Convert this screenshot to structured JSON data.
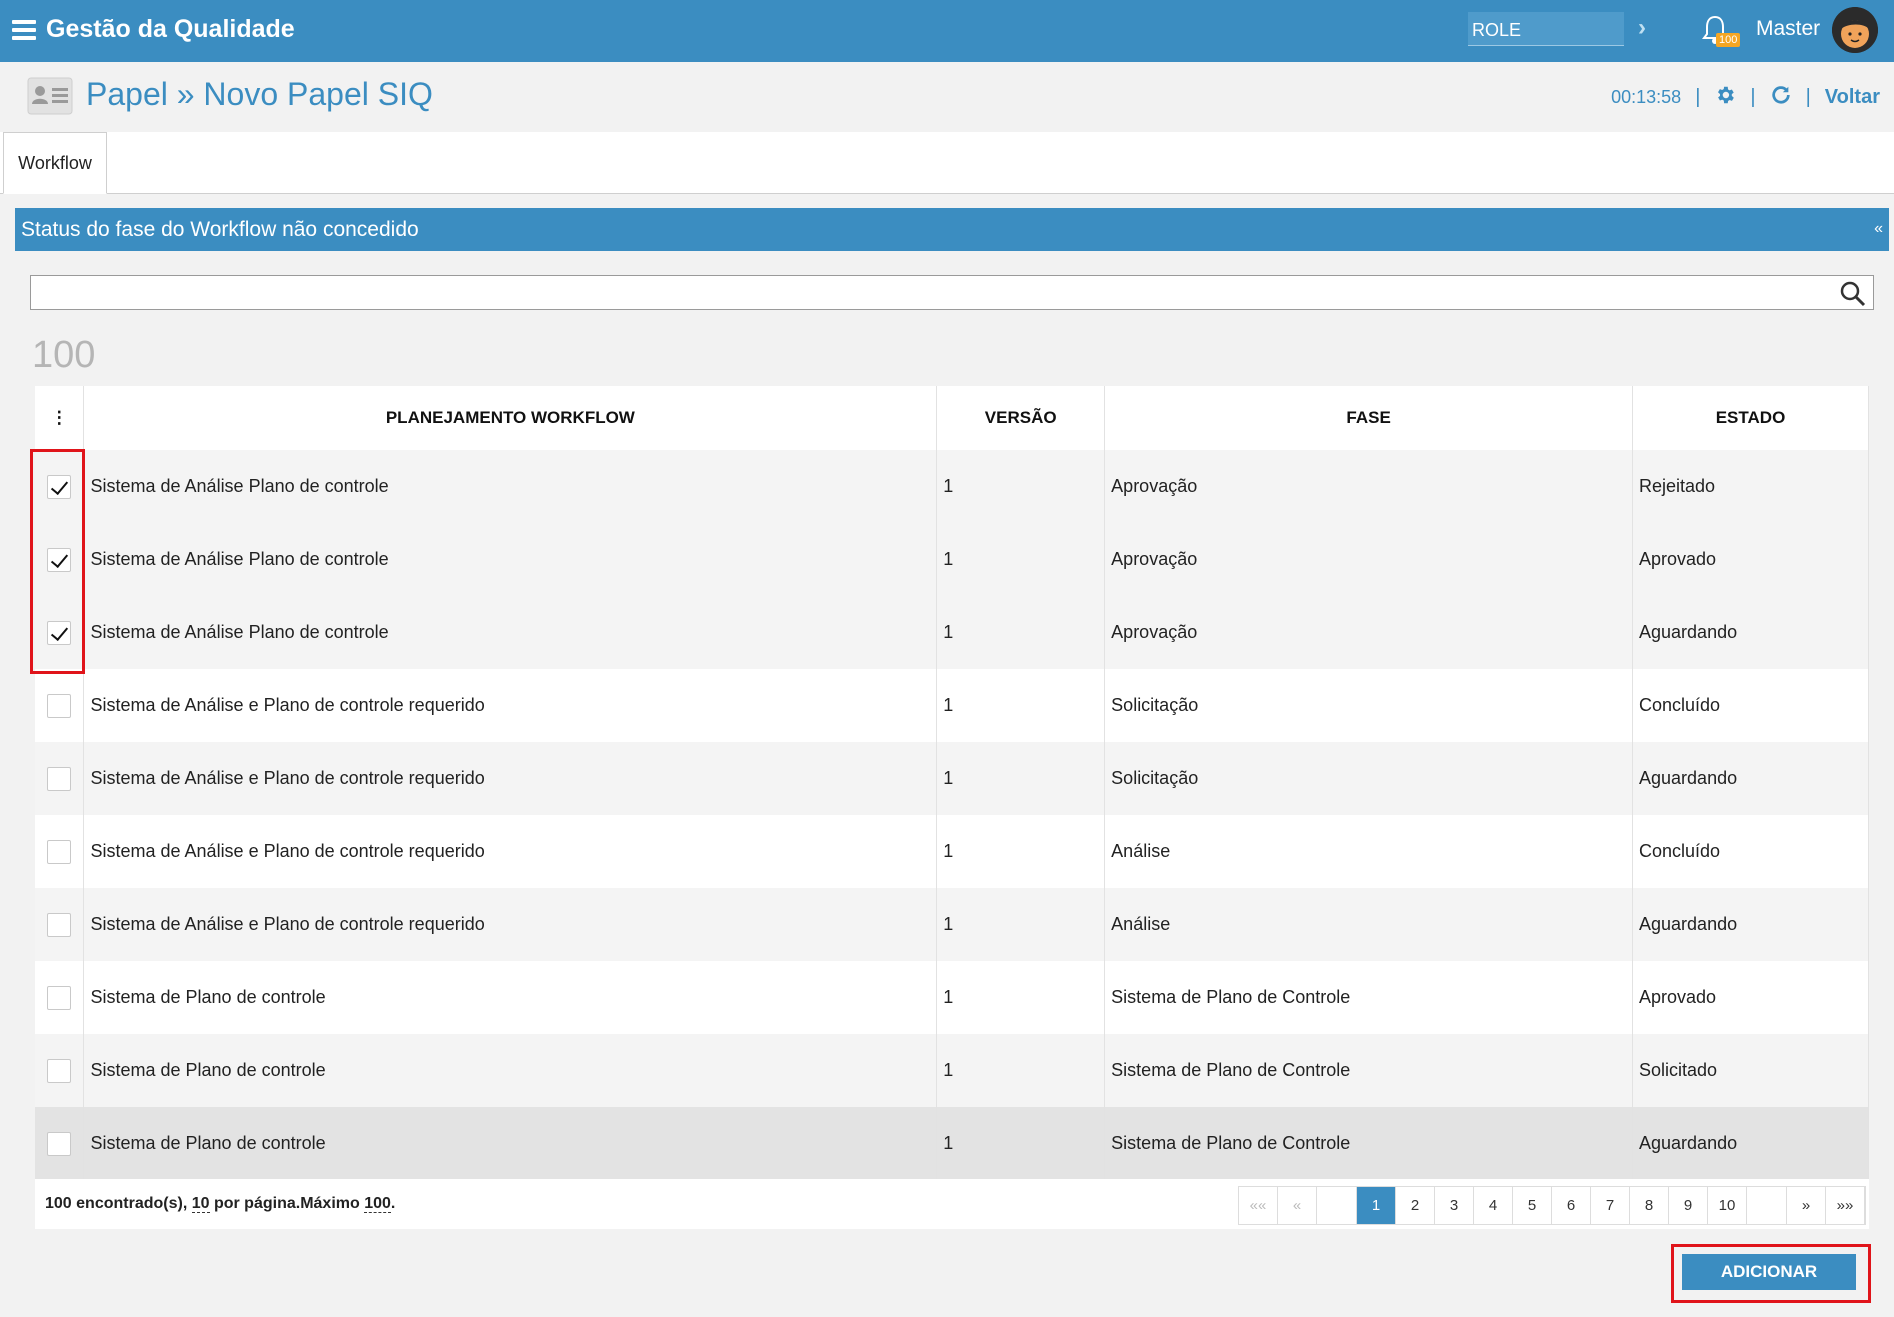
{
  "app": {
    "title": "Gestão da Qualidade"
  },
  "topbar": {
    "role": "ROLE",
    "notification_count": "100",
    "user_name": "Master"
  },
  "page": {
    "title": "Papel » Novo Papel SIQ",
    "timer": "00:13:58",
    "back_label": "Voltar"
  },
  "tabs": [
    {
      "label": "Workflow"
    }
  ],
  "panel": {
    "title": "Status do fase do Workflow não concedido",
    "collapse_glyph": "«"
  },
  "search": {
    "placeholder": ""
  },
  "count_display": "100",
  "table": {
    "columns": [
      "PLANEJAMENTO WORKFLOW",
      "VERSÃO",
      "FASE",
      "ESTADO"
    ],
    "rows": [
      {
        "checked": true,
        "plan": "Sistema de Análise Plano de controle",
        "version": "1",
        "phase": "Aprovação",
        "state": "Rejeitado"
      },
      {
        "checked": true,
        "plan": "Sistema de Análise Plano de controle",
        "version": "1",
        "phase": "Aprovação",
        "state": "Aprovado"
      },
      {
        "checked": true,
        "plan": "Sistema de Análise Plano de controle",
        "version": "1",
        "phase": "Aprovação",
        "state": "Aguardando"
      },
      {
        "checked": false,
        "plan": "Sistema de Análise e Plano de controle requerido",
        "version": "1",
        "phase": "Solicitação",
        "state": "Concluído"
      },
      {
        "checked": false,
        "plan": "Sistema de Análise e Plano de controle requerido",
        "version": "1",
        "phase": "Solicitação",
        "state": "Aguardando"
      },
      {
        "checked": false,
        "plan": "Sistema de Análise e Plano de controle requerido",
        "version": "1",
        "phase": "Análise",
        "state": "Concluído"
      },
      {
        "checked": false,
        "plan": "Sistema de Análise e Plano de controle requerido",
        "version": "1",
        "phase": "Análise",
        "state": "Aguardando"
      },
      {
        "checked": false,
        "plan": "Sistema de Plano de controle",
        "version": "1",
        "phase": "Sistema de Plano de Controle",
        "state": "Aprovado"
      },
      {
        "checked": false,
        "plan": "Sistema de Plano de controle",
        "version": "1",
        "phase": "Sistema de Plano de Controle",
        "state": "Solicitado"
      },
      {
        "checked": false,
        "plan": "Sistema de Plano de controle",
        "version": "1",
        "phase": "Sistema de Plano de Controle",
        "state": "Aguardando"
      }
    ]
  },
  "footer": {
    "found_count": "100",
    "found_text": " encontrado(s), ",
    "per_page": "10",
    "per_page_text": " por página.Máximo ",
    "max": "100",
    "max_suffix": "."
  },
  "pager": {
    "first": "««",
    "prev": "«",
    "pages": [
      "1",
      "2",
      "3",
      "4",
      "5",
      "6",
      "7",
      "8",
      "9",
      "10"
    ],
    "active": "1",
    "next": "»",
    "last": "»»"
  },
  "actions": {
    "add_label": "ADICIONAR"
  },
  "colors": {
    "primary": "#3b8dc1",
    "highlight": "#e0141a",
    "badge": "#f5a623"
  }
}
